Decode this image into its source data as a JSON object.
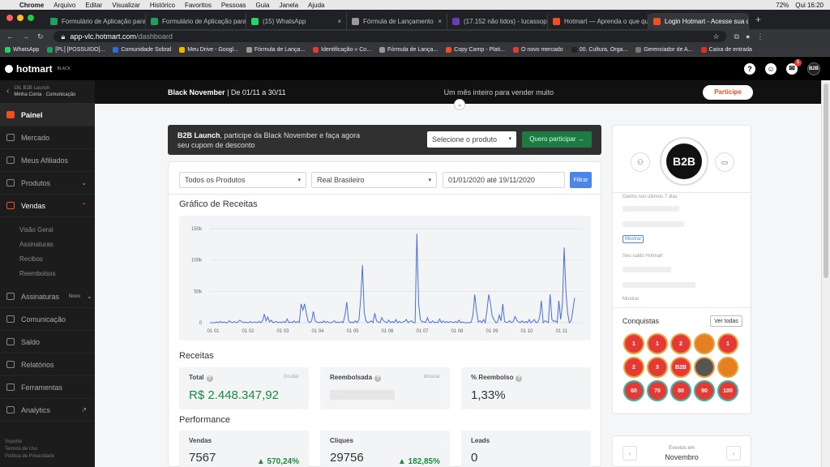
{
  "mac_menu": {
    "apple": "",
    "items": [
      "Chrome",
      "Arquivo",
      "Editar",
      "Visualizar",
      "Histórico",
      "Favoritos",
      "Pessoas",
      "Guia",
      "Janela",
      "Ajuda"
    ],
    "battery": "72%",
    "clock": "Qui 16:20"
  },
  "tabs": [
    {
      "title": "Formulário de Aplicação para l",
      "color": "#1aa260"
    },
    {
      "title": "Formulário de Aplicação para l",
      "color": "#1aa260"
    },
    {
      "title": "(15) WhatsApp",
      "color": "#25d366"
    },
    {
      "title": "Fórmula de Lançamento",
      "color": "#999999"
    },
    {
      "title": "(17.152 não lidos) - lucassopp",
      "color": "#6a3db8"
    },
    {
      "title": "Hotmart — Aprenda o que qui",
      "color": "#f04e23"
    },
    {
      "title": "Login Hotmart - Acesse sua c",
      "color": "#f04e23"
    }
  ],
  "url": {
    "host": "app-vlc.hotmart.com",
    "path": "/dashboard"
  },
  "bookmarks": [
    "WhatsApp",
    "[PL] [POSSUIDO]...",
    "Comunidade Sobral",
    "Meu Drive - Googl...",
    "Fórmula de Lança...",
    "Identificação » Co...",
    "Fórmula de Lança...",
    "Copy Camp - Plati...",
    "O novo mercado",
    "00. Cultura, Orga...",
    "Gerenciador de A...",
    "Caixa de entrada"
  ],
  "header": {
    "logo": "hotmart",
    "logo_sub": "BLACK",
    "badge": "1",
    "avatar": "B2B"
  },
  "sidebar": {
    "crumb_title": "OIL B2B Launch",
    "crumb_sub": "Minha Conta · Comunicação",
    "items": [
      {
        "label": "Painel",
        "active": true
      },
      {
        "label": "Mercado"
      },
      {
        "label": "Meus Afiliados"
      },
      {
        "label": "Produtos",
        "chevron": "⌄"
      },
      {
        "label": "Vendas",
        "chevron": "⌃",
        "open": true
      }
    ],
    "vendas_sub": [
      "Visão Geral",
      "Assinaturas",
      "Recibos",
      "Reembolsos"
    ],
    "items2": [
      {
        "label": "Assinaturas",
        "tag": "Novo",
        "chevron": "⌄"
      },
      {
        "label": "Comunicação"
      },
      {
        "label": "Saldo"
      },
      {
        "label": "Relatórios"
      },
      {
        "label": "Ferramentas"
      },
      {
        "label": "Analytics"
      }
    ],
    "footer": [
      "Suporte",
      "Termos de Uso",
      "Política de Privacidade"
    ]
  },
  "banner": {
    "title": "Black November",
    "dates": "| De 01/11 a 30/11",
    "middle": "Um mês inteiro para vender muito",
    "button": "Participe"
  },
  "promo": {
    "bold": "B2B Launch",
    "text": ", participe da Black November e faça agora",
    "text2": "seu cupom de desconto",
    "select": "Selecione o produto",
    "button": "Quero participar →"
  },
  "filters": {
    "product": "Todos os Produtos",
    "currency": "Real Brasileiro",
    "date_range": "01/01/2020 até 19/11/2020",
    "button": "Filtrar"
  },
  "chart_title": "Gráfico de Receitas",
  "chart_data": {
    "type": "line",
    "yticks": [
      "150k",
      "100k",
      "50k",
      "0"
    ],
    "y_values": [
      150000,
      100000,
      50000,
      0
    ],
    "ylim": [
      0,
      150000
    ],
    "xticks": [
      "01 01",
      "01 02",
      "01 03",
      "01 04",
      "01 05",
      "01 06",
      "01 07",
      "01 08",
      "01 09",
      "01 10",
      "01 11"
    ],
    "series": [
      {
        "color": "#4a6fdc",
        "values": [
          0,
          0,
          0,
          0,
          1000,
          0,
          2000,
          0,
          1000,
          0,
          0,
          3000,
          1000,
          0,
          2000,
          0,
          1000,
          4000,
          2000,
          0,
          1000,
          0,
          0,
          2000,
          0,
          1000,
          1000,
          0,
          2000,
          0,
          3000,
          14000,
          3000,
          9000,
          1000,
          4000,
          0,
          1000,
          2000,
          0,
          1000,
          0,
          2000,
          0,
          6000,
          0,
          1000,
          0,
          3000,
          0,
          2000,
          0,
          30000,
          20000,
          30000,
          15000,
          2000,
          0,
          3000,
          18000,
          3000,
          1000,
          0,
          1000,
          0,
          3000,
          0,
          2000,
          0,
          0,
          1000,
          3000,
          0,
          1000,
          0,
          2000,
          0,
          12000,
          33000,
          4000,
          0,
          1000,
          0,
          3000,
          0,
          5000,
          40000,
          92000,
          16000,
          3000,
          0,
          1000,
          3000,
          0,
          15000,
          3000,
          1000,
          0,
          8000,
          3000,
          1000,
          0,
          4000,
          0,
          2000,
          0,
          5000,
          0,
          2000,
          0,
          1000,
          2000,
          5000,
          0,
          2000,
          3000,
          0,
          0,
          142000,
          30000,
          5000,
          1000,
          2000,
          0,
          8000,
          1000,
          0,
          3000,
          0,
          1000,
          0,
          6000,
          0,
          3000,
          0,
          2000,
          0,
          2000,
          1000,
          0,
          2000,
          0,
          4000,
          0,
          1000,
          0,
          0,
          0,
          0,
          1000,
          12000,
          45000,
          20000,
          1000,
          3000,
          0,
          5000,
          0,
          20000,
          45000,
          30000,
          10000,
          5000,
          0,
          1000,
          12000,
          3000,
          30000,
          2000,
          0,
          1000,
          3000,
          0,
          2000,
          10000,
          4000,
          1000,
          0,
          3000,
          0,
          2000,
          0,
          5000,
          0,
          2000,
          5000,
          0,
          1000,
          8000,
          35000,
          0,
          3000,
          2000,
          0,
          45000,
          5000,
          2000,
          3000,
          0,
          35000,
          5000,
          30000,
          120000,
          50000,
          15000,
          0,
          3000,
          20000,
          40000
        ]
      }
    ]
  },
  "receitas": {
    "title": "Receitas",
    "cards": [
      {
        "label": "Total",
        "hint": "Ocultar",
        "value": "R$ 2.448.347,92",
        "green": true
      },
      {
        "label": "Reembolsada",
        "hint": "Mostrar",
        "value": ""
      },
      {
        "label": "% Reembolso",
        "value": "1,33%"
      }
    ]
  },
  "performance": {
    "title": "Performance",
    "cards": [
      {
        "label": "Vendas",
        "value": "7567",
        "delta": "▲ 570,24%"
      },
      {
        "label": "Cliques",
        "value": "29756",
        "delta": "▲ 182,85%"
      },
      {
        "label": "Leads",
        "value": "0"
      }
    ]
  },
  "right_panel": {
    "avatar": "B2B",
    "ganho_label": "Ganho nos últimos 7 dias",
    "saldo_label": "Seu saldo Hotmart",
    "mostrar": "Mostrar",
    "conquistas": "Conquistas",
    "ver_todas": "Ver todas",
    "medals": [
      {
        "label": "1",
        "color": "#e53935"
      },
      {
        "label": "1",
        "color": "#e53935"
      },
      {
        "label": "2",
        "color": "#e53935"
      },
      {
        "label": "",
        "color": "#e67e22"
      },
      {
        "label": "1",
        "color": "#e53935"
      },
      {
        "label": "2",
        "color": "#e53935"
      },
      {
        "label": "3",
        "color": "#e53935"
      },
      {
        "label": "B2B",
        "color": "#e53935"
      },
      {
        "label": "",
        "color": "#555"
      },
      {
        "label": "",
        "color": "#e67e22"
      },
      {
        "label": "60",
        "color": "#e53935"
      },
      {
        "label": "70",
        "color": "#e53935"
      },
      {
        "label": "80",
        "color": "#e53935"
      },
      {
        "label": "90",
        "color": "#e53935"
      },
      {
        "label": "100",
        "color": "#e53935"
      }
    ]
  },
  "events": {
    "title": "Eventos em",
    "month": "Novembro"
  }
}
